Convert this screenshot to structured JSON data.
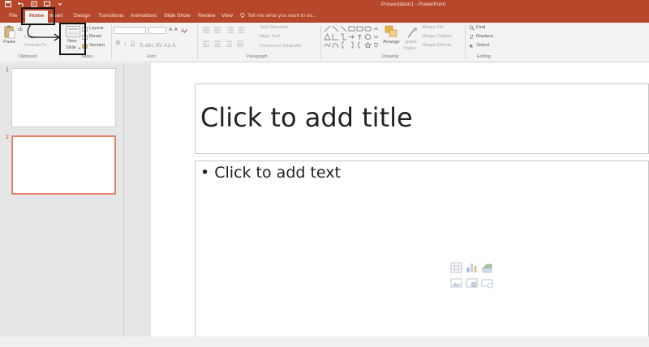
{
  "window": {
    "title": "Presentation1 - PowerPoint"
  },
  "tabs": [
    {
      "label": "File"
    },
    {
      "label": "Home"
    },
    {
      "label": "Insert"
    },
    {
      "label": "Design"
    },
    {
      "label": "Transitions"
    },
    {
      "label": "Animations"
    },
    {
      "label": "Slide Show"
    },
    {
      "label": "Review"
    },
    {
      "label": "View"
    }
  ],
  "tell_me": {
    "placeholder": "Tell me what you want to do..."
  },
  "ribbon": {
    "clipboard": {
      "label": "Clipboard",
      "paste": "Paste",
      "copy": "Copy",
      "format_painter": "Format Pa"
    },
    "slides": {
      "label": "Slides",
      "new_slide_1": "New",
      "new_slide_2": "Slide",
      "layout": "Layout",
      "reset": "Reset",
      "section": "Section"
    },
    "font": {
      "label": "Font",
      "bold": "B",
      "italic": "I",
      "underline": "U"
    },
    "paragraph": {
      "label": "Paragraph",
      "text_direction": "Text Direction",
      "align_text": "Align Text",
      "convert_smartart": "Convert to SmartArt"
    },
    "drawing": {
      "label": "Drawing",
      "arrange": "Arrange",
      "quick_styles_1": "Quick",
      "quick_styles_2": "Styles",
      "shape_fill": "Shape Fill",
      "shape_outline": "Shape Outline",
      "shape_effects": "Shape Effects"
    },
    "editing": {
      "label": "Editing",
      "find": "Find",
      "replace": "Replace",
      "select": "Select"
    }
  },
  "thumbnails": [
    {
      "number": "1"
    },
    {
      "number": "2"
    }
  ],
  "slide": {
    "title_placeholder": "Click to add title",
    "body_placeholder": "• Click to add text"
  },
  "colors": {
    "accent": "#b7472a",
    "selection": "#e5816b"
  }
}
